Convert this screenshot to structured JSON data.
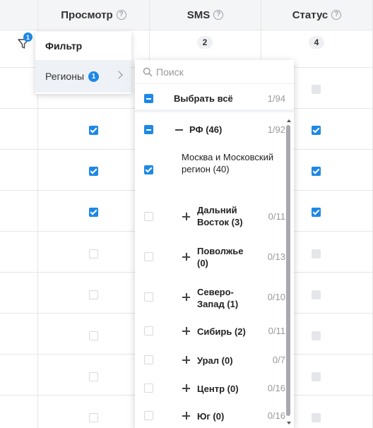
{
  "table": {
    "columns": [
      {
        "label": "Просмотр"
      },
      {
        "label": "SMS"
      },
      {
        "label": "Статус"
      }
    ],
    "help_glyph": "?",
    "counts": {
      "sms": "2",
      "status": "4"
    },
    "filter_badge": "1"
  },
  "menu": {
    "title": "Фильтр",
    "item_label": "Регионы",
    "item_badge": "1"
  },
  "dropdown": {
    "search_placeholder": "Поиск",
    "select_all": {
      "label": "Выбрать всё",
      "count": "1/94"
    },
    "items": [
      {
        "label": "РФ (46)",
        "count": "1/92"
      },
      {
        "label": "Москва и Московский регион (40)",
        "count": ""
      },
      {
        "label": "Дальний Восток (3)",
        "count": "0/11"
      },
      {
        "label": "Поволжье (0)",
        "count": "0/13"
      },
      {
        "label": "Северо-Запад (1)",
        "count": "0/10"
      },
      {
        "label": "Сибирь (2)",
        "count": "0/11"
      },
      {
        "label": "Урал (0)",
        "count": "0/7"
      },
      {
        "label": "Центр (0)",
        "count": "0/16"
      },
      {
        "label": "Юг (0)",
        "count": "0/16"
      }
    ]
  },
  "colors": {
    "accent": "#1e88e5",
    "header_bg": "#f4f5f7"
  }
}
